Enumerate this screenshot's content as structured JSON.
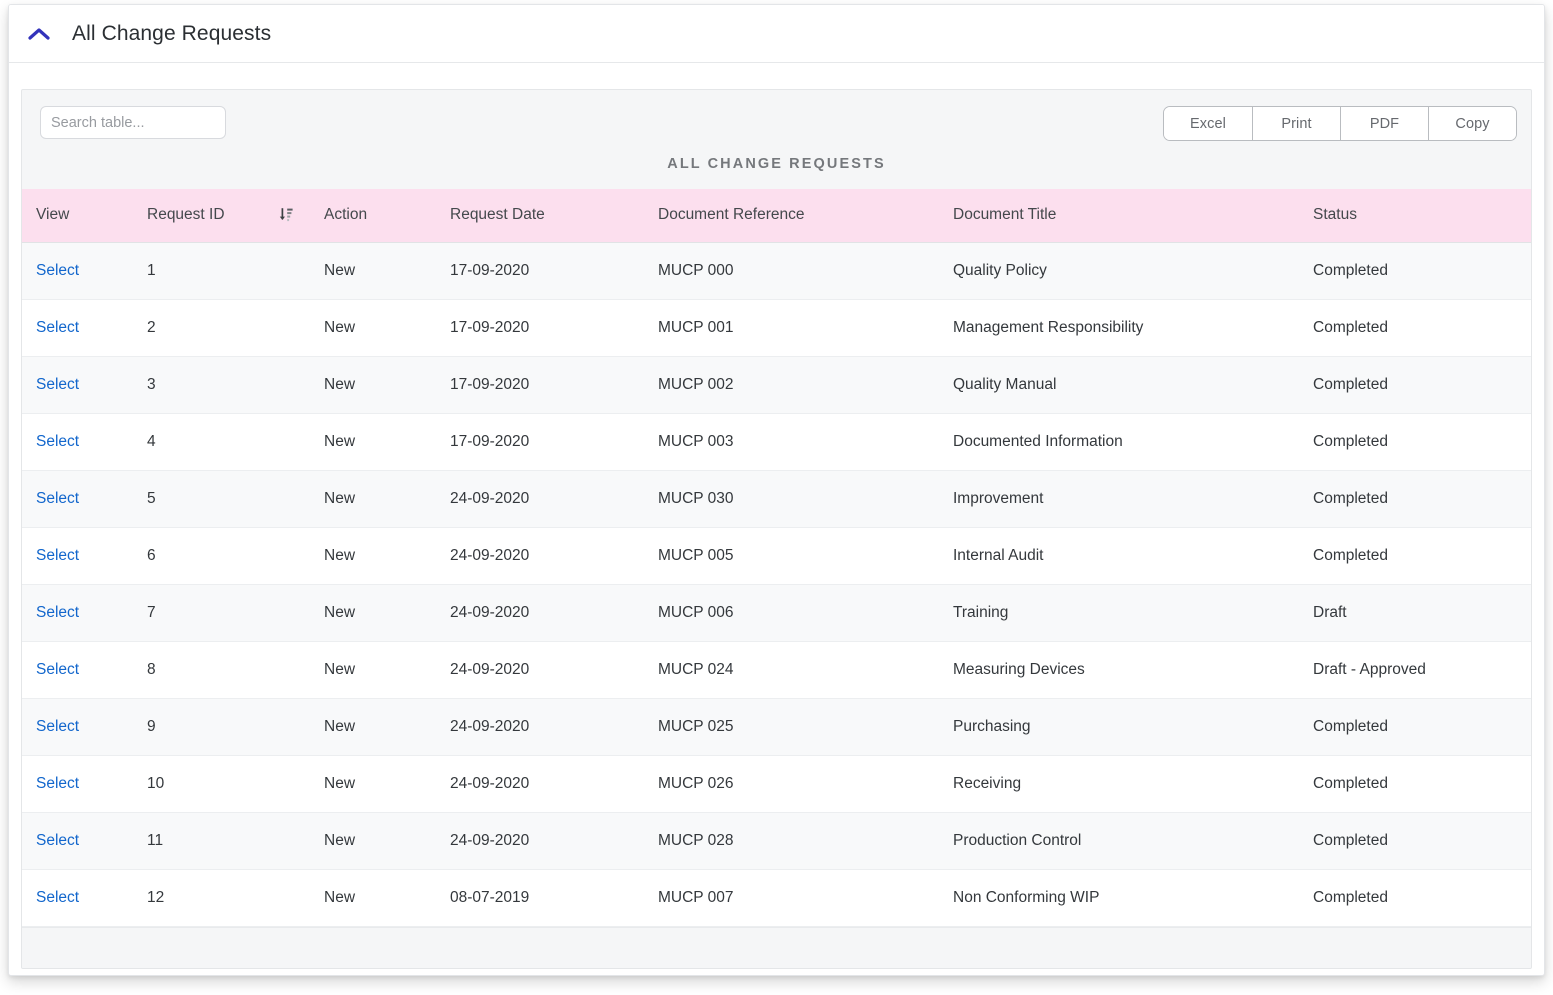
{
  "card": {
    "title": "All Change Requests",
    "collapse_icon": "chevron-up-icon"
  },
  "toolbar": {
    "search": {
      "placeholder": "Search table...",
      "value": ""
    },
    "export_buttons": [
      {
        "label": "Excel"
      },
      {
        "label": "Print"
      },
      {
        "label": "PDF"
      },
      {
        "label": "Copy"
      }
    ]
  },
  "table": {
    "caption": "ALL CHANGE REQUESTS",
    "sort_icon": "sort-amount-down-icon",
    "sorted_column": "Request ID",
    "columns": [
      {
        "key": "view",
        "label": "View"
      },
      {
        "key": "request_id",
        "label": "Request ID"
      },
      {
        "key": "action",
        "label": "Action"
      },
      {
        "key": "request_date",
        "label": "Request Date"
      },
      {
        "key": "document_reference",
        "label": "Document Reference"
      },
      {
        "key": "document_title",
        "label": "Document Title"
      },
      {
        "key": "status",
        "label": "Status"
      }
    ],
    "row_action_label": "Select",
    "rows": [
      {
        "view": "Select",
        "request_id": "1",
        "action": "New",
        "request_date": "17-09-2020",
        "document_reference": "MUCP 000",
        "document_title": "Quality Policy",
        "status": "Completed"
      },
      {
        "view": "Select",
        "request_id": "2",
        "action": "New",
        "request_date": "17-09-2020",
        "document_reference": "MUCP 001",
        "document_title": "Management Responsibility",
        "status": "Completed"
      },
      {
        "view": "Select",
        "request_id": "3",
        "action": "New",
        "request_date": "17-09-2020",
        "document_reference": "MUCP 002",
        "document_title": "Quality Manual",
        "status": "Completed"
      },
      {
        "view": "Select",
        "request_id": "4",
        "action": "New",
        "request_date": "17-09-2020",
        "document_reference": "MUCP 003",
        "document_title": "Documented Information",
        "status": "Completed"
      },
      {
        "view": "Select",
        "request_id": "5",
        "action": "New",
        "request_date": "24-09-2020",
        "document_reference": "MUCP 030",
        "document_title": "Improvement",
        "status": "Completed"
      },
      {
        "view": "Select",
        "request_id": "6",
        "action": "New",
        "request_date": "24-09-2020",
        "document_reference": "MUCP 005",
        "document_title": "Internal Audit",
        "status": "Completed"
      },
      {
        "view": "Select",
        "request_id": "7",
        "action": "New",
        "request_date": "24-09-2020",
        "document_reference": "MUCP 006",
        "document_title": "Training",
        "status": "Draft"
      },
      {
        "view": "Select",
        "request_id": "8",
        "action": "New",
        "request_date": "24-09-2020",
        "document_reference": "MUCP 024",
        "document_title": "Measuring Devices",
        "status": "Draft - Approved"
      },
      {
        "view": "Select",
        "request_id": "9",
        "action": "New",
        "request_date": "24-09-2020",
        "document_reference": "MUCP 025",
        "document_title": "Purchasing",
        "status": "Completed"
      },
      {
        "view": "Select",
        "request_id": "10",
        "action": "New",
        "request_date": "24-09-2020",
        "document_reference": "MUCP 026",
        "document_title": "Receiving",
        "status": "Completed"
      },
      {
        "view": "Select",
        "request_id": "11",
        "action": "New",
        "request_date": "24-09-2020",
        "document_reference": "MUCP 028",
        "document_title": "Production Control",
        "status": "Completed"
      },
      {
        "view": "Select",
        "request_id": "12",
        "action": "New",
        "request_date": "08-07-2019",
        "document_reference": "MUCP 007",
        "document_title": "Non Conforming WIP",
        "status": "Completed"
      }
    ]
  },
  "colors": {
    "header_pink": "#fcdfee",
    "link_blue": "#1266cc",
    "chevron_indigo": "#3333bb",
    "row_stripe": "#f8f9fa",
    "panel_bg": "#f5f6f7"
  }
}
